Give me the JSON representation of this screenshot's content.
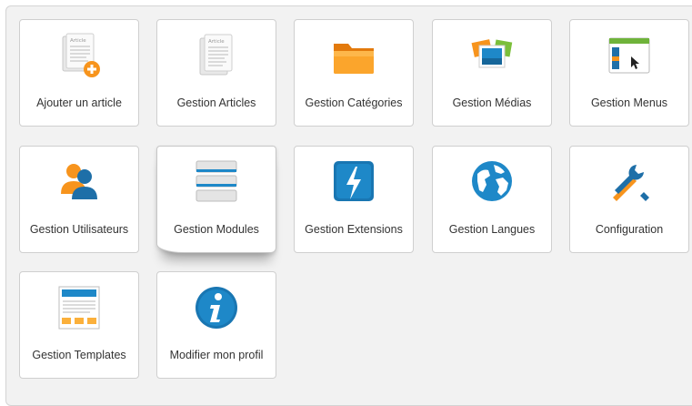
{
  "tiles": [
    {
      "label": "Ajouter un article",
      "icon": "add-article-icon"
    },
    {
      "label": "Gestion Articles",
      "icon": "articles-icon"
    },
    {
      "label": "Gestion Catégories",
      "icon": "folder-icon"
    },
    {
      "label": "Gestion Médias",
      "icon": "media-icon"
    },
    {
      "label": "Gestion Menus",
      "icon": "menu-window-icon"
    },
    {
      "label": "Gestion Utilisateurs",
      "icon": "users-icon"
    },
    {
      "label": "Gestion Modules",
      "icon": "modules-icon"
    },
    {
      "label": "Gestion Extensions",
      "icon": "extensions-icon"
    },
    {
      "label": "Gestion Langues",
      "icon": "globe-icon"
    },
    {
      "label": "Configuration",
      "icon": "tools-icon"
    },
    {
      "label": "Gestion Templates",
      "icon": "template-icon"
    },
    {
      "label": "Modifier mon profil",
      "icon": "info-icon"
    }
  ],
  "icon_mini_text": "Article",
  "colors": {
    "panel_background": "#f2f2f2",
    "tile_background": "#ffffff",
    "tile_border": "#cfcfcf",
    "label_text": "#333333",
    "accent_orange": "#f7941d",
    "accent_blue": "#1e88c8"
  }
}
